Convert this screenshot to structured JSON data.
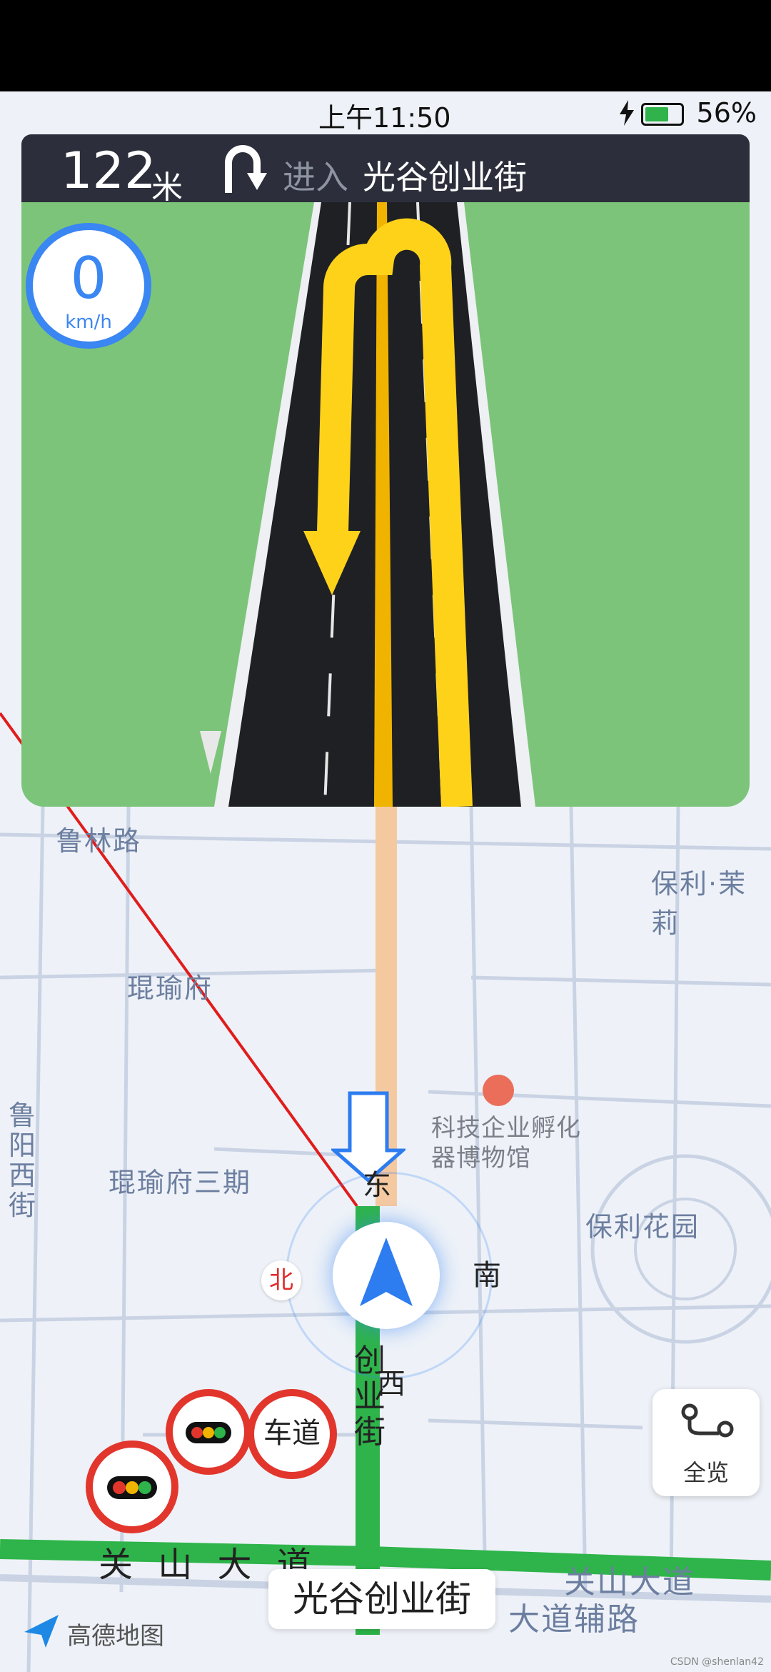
{
  "status_bar": {
    "time": "上午11:50",
    "battery": "56%"
  },
  "guidance": {
    "distance": "122",
    "distance_unit": "米",
    "enter_label": "进入",
    "road": "光谷创业街"
  },
  "speed": {
    "value": "0",
    "unit": "km/h"
  },
  "map_labels": {
    "road_top": "鲁林路",
    "place1": "琨瑜府",
    "place2": "琨瑜府三期",
    "road_left": "鲁阳西街",
    "poi": "科技企业孵化器博物馆",
    "place3": "保利花园",
    "place4": "保利·茉莉",
    "road_main": "关 山 大 道",
    "road_right": "关山大道",
    "road_right2": "大道辅路",
    "road_vertical": "创业街"
  },
  "compass": {
    "north": "北",
    "east": "东",
    "south": "南",
    "west": "西"
  },
  "traffic_badge": {
    "lane_label": "车道"
  },
  "overview_button": {
    "label": "全览"
  },
  "current_road": "光谷创业街",
  "logo": "高德地图",
  "watermark": "CSDN @shenlan42",
  "colors": {
    "route_green": "#2eb44a",
    "route_orange": "#f5c9a0",
    "accent_blue": "#3a86f2",
    "nav_bg": "#2c2f3b"
  }
}
